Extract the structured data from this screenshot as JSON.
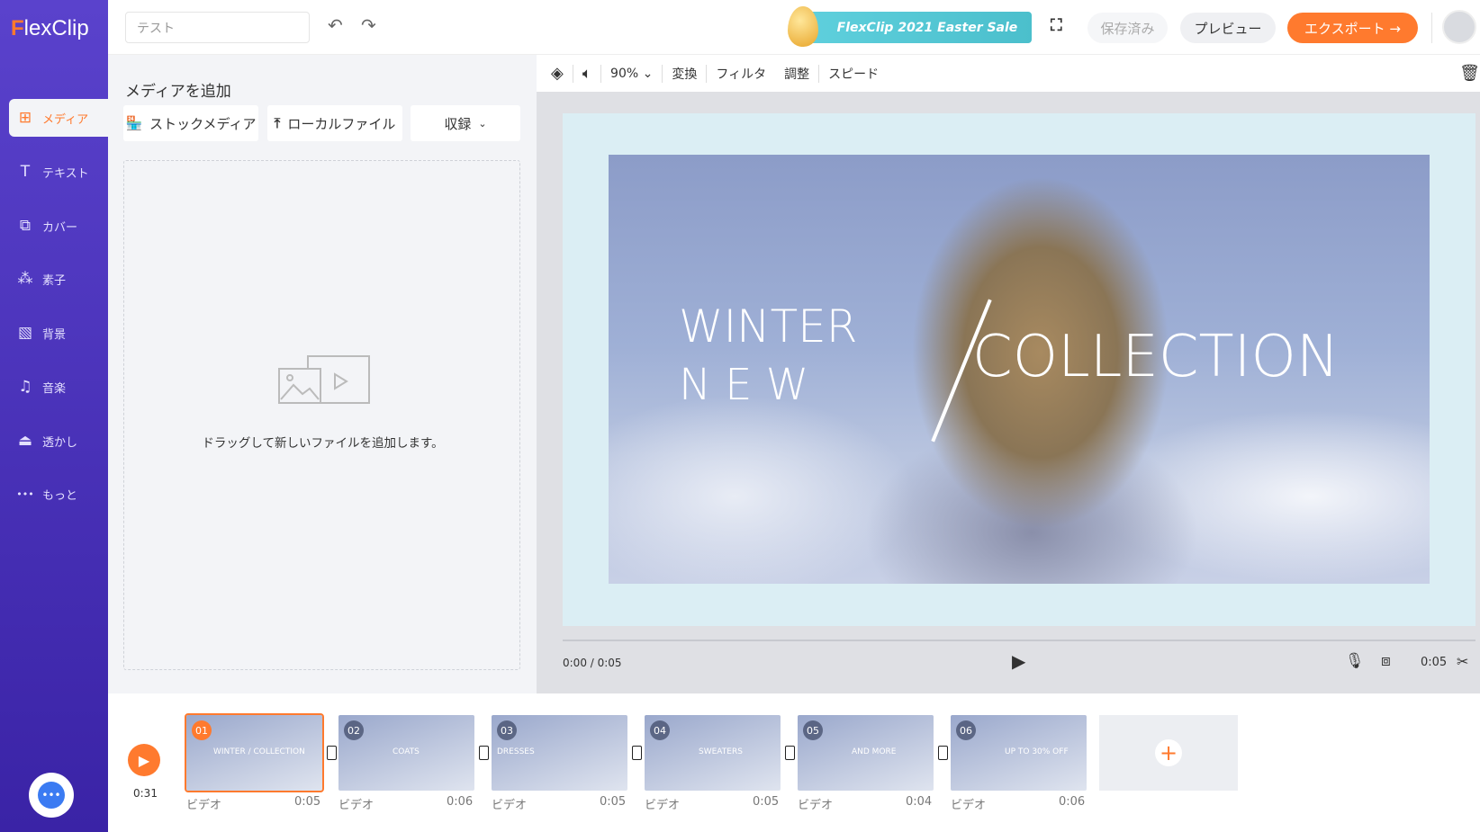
{
  "app": {
    "logo_f": "F",
    "logo_rest": "lexClip"
  },
  "sidebar": {
    "items": [
      {
        "label": "メディア",
        "icon": "media-folder-icon",
        "glyph": "⊞"
      },
      {
        "label": "テキスト",
        "icon": "text-icon",
        "glyph": "T"
      },
      {
        "label": "カバー",
        "icon": "cover-icon",
        "glyph": "⧉"
      },
      {
        "label": "素子",
        "icon": "elements-icon",
        "glyph": "⁂"
      },
      {
        "label": "背景",
        "icon": "background-icon",
        "glyph": "▧"
      },
      {
        "label": "音楽",
        "icon": "music-icon",
        "glyph": "♫"
      },
      {
        "label": "透かし",
        "icon": "watermark-icon",
        "glyph": "⏏"
      },
      {
        "label": "もっと",
        "icon": "more-icon",
        "glyph": "•••"
      }
    ]
  },
  "topbar": {
    "title_value": "テスト",
    "banner": "FlexClip 2021 Easter Sale",
    "saved": "保存済み",
    "preview": "プレビュー",
    "export": "エクスポート →"
  },
  "panel": {
    "heading": "メディアを追加",
    "stock": "ストックメディア",
    "local": "ローカルファイル",
    "record": "収録",
    "drop_text": "ドラッグして新しいファイルを追加します。"
  },
  "toolbar": {
    "zoom": "90%",
    "transform": "変換",
    "filter": "フィルタ",
    "adjust": "調整",
    "speed": "スピード"
  },
  "canvas": {
    "line1": "WINTER",
    "line2": "N E W",
    "line3": "COLLECTION"
  },
  "player": {
    "time": "0:00 / 0:05",
    "duration": "0:05",
    "progress": 0
  },
  "timeline": {
    "total": "0:31",
    "clips": [
      {
        "num": "01",
        "type": "ビデオ",
        "duration": "0:05",
        "caption": "WINTER / COLLECTION"
      },
      {
        "num": "02",
        "type": "ビデオ",
        "duration": "0:06",
        "caption": "COATS"
      },
      {
        "num": "03",
        "type": "ビデオ",
        "duration": "0:05",
        "caption": "DRESSES"
      },
      {
        "num": "04",
        "type": "ビデオ",
        "duration": "0:05",
        "caption": "SWEATERS"
      },
      {
        "num": "05",
        "type": "ビデオ",
        "duration": "0:04",
        "caption": "AND MORE"
      },
      {
        "num": "06",
        "type": "ビデオ",
        "duration": "0:06",
        "caption": "UP TO 30% OFF"
      }
    ]
  },
  "colors": {
    "accent": "#ff7a2e",
    "sidebar": "#4a32b8",
    "banner": "#55c8d5"
  }
}
